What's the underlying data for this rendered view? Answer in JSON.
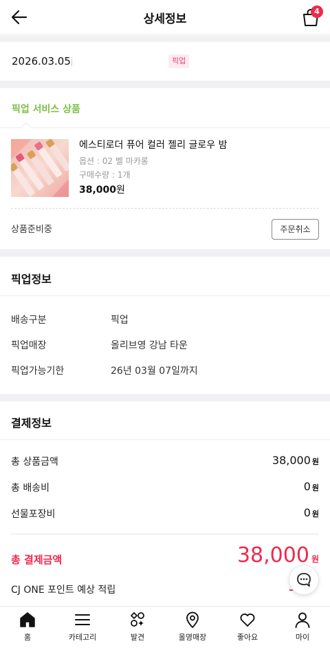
{
  "header": {
    "title": "상세정보",
    "cart_count": "4",
    "back_icon": "arrow-left-icon",
    "cart_icon": "shopping-bag-icon"
  },
  "order": {
    "date": "2026.03.05",
    "type_tag": "픽업"
  },
  "service": {
    "title": "픽업 서비스 상품"
  },
  "product": {
    "name": "에스티로더 퓨어 컬러 젤리 글로우 밤",
    "option": "옵션 : 02 벨 마카롱",
    "quantity": "구매수량 : 1개",
    "price": "38,000",
    "price_unit": "원",
    "status": "상품준비중",
    "cancel_label": "주문취소"
  },
  "pickup_info": {
    "title": "픽업정보",
    "rows": [
      {
        "label": "배송구분",
        "value": "픽업"
      },
      {
        "label": "픽업매장",
        "value": "올리브영 강남 타운"
      },
      {
        "label": "픽업가능기한",
        "value": "26년 03월 07일까지"
      }
    ]
  },
  "payment": {
    "title": "결제정보",
    "rows": [
      {
        "label": "총 상품금액",
        "value": "38,000",
        "unit": "원"
      },
      {
        "label": "총 배송비",
        "value": "0",
        "unit": "원"
      },
      {
        "label": "선물포장비",
        "value": "0",
        "unit": "원"
      }
    ],
    "total_label": "총 결제금액",
    "total_value": "38,000",
    "total_unit": "원",
    "cj_label": "CJ ONE 포인트 예상 적립",
    "cj_value": "380P"
  },
  "nav": {
    "items": [
      {
        "label": "홈",
        "icon": "home-icon"
      },
      {
        "label": "카테고리",
        "icon": "menu-icon"
      },
      {
        "label": "발견",
        "icon": "discover-icon"
      },
      {
        "label": "올영매장",
        "icon": "location-pin-icon"
      },
      {
        "label": "좋아요",
        "icon": "heart-icon"
      },
      {
        "label": "마이",
        "icon": "person-icon"
      }
    ]
  },
  "colors": {
    "accent_red": "#ee2a4e",
    "pickup_green": "#7cc049",
    "tag_pink": "#e8457c"
  }
}
